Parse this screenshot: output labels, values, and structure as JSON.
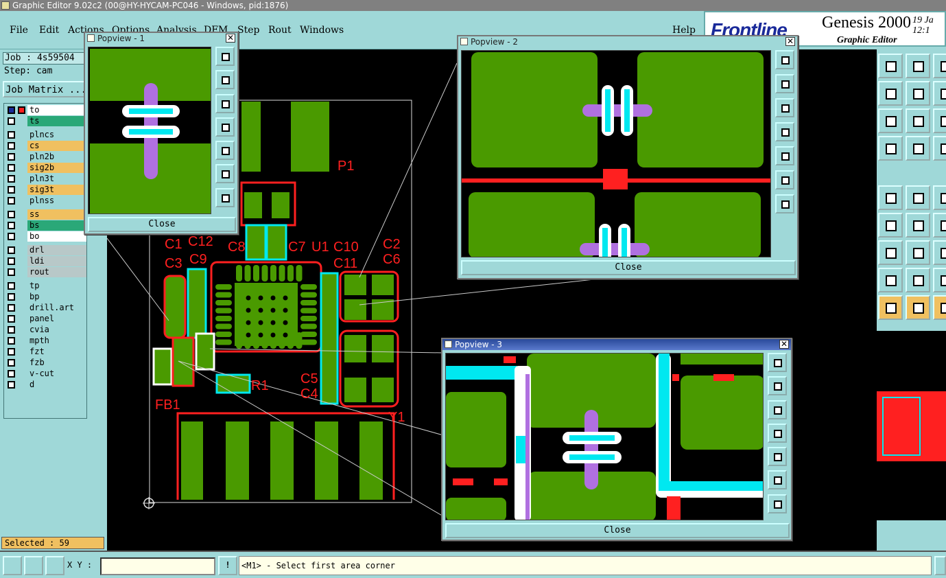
{
  "window": {
    "title": "Graphic Editor 9.02c2 (00@HY-HYCAM-PC046 - Windows, pid:1876)"
  },
  "menu": [
    "File",
    "Edit",
    "Actions",
    "Options",
    "Analysis",
    "DFM",
    "Step",
    "Rout",
    "Windows",
    "Help"
  ],
  "brand": {
    "logo": "Frontline",
    "product": "Genesis 2000",
    "subtitle": "Graphic Editor",
    "date": "19 Ja",
    "time": "12:1"
  },
  "job": {
    "job_label": "Job : 4s59504",
    "step_label": "Step: cam",
    "matrix_button": "Job Matrix ..."
  },
  "layers": [
    {
      "name": "to",
      "color": "#ffffff"
    },
    {
      "name": "ts",
      "color": "#2aa878"
    },
    {
      "name": "plncs",
      "color": "#9fd8d8"
    },
    {
      "name": "cs",
      "color": "#f0c060"
    },
    {
      "name": "pln2b",
      "color": "#9fd8d8"
    },
    {
      "name": "sig2b",
      "color": "#f0c060"
    },
    {
      "name": "pln3t",
      "color": "#9fd8d8"
    },
    {
      "name": "sig3t",
      "color": "#f0c060"
    },
    {
      "name": "plnss",
      "color": "#9fd8d8"
    },
    {
      "name": "ss",
      "color": "#f0c060"
    },
    {
      "name": "bs",
      "color": "#2aa878"
    },
    {
      "name": "bo",
      "color": "#ffffff"
    },
    {
      "name": "drl",
      "color": "#b8c8c8"
    },
    {
      "name": "ldi",
      "color": "#b8c8c8"
    },
    {
      "name": "rout",
      "color": "#b8c8c8"
    },
    {
      "name": "tp",
      "color": "#9fd8d8"
    },
    {
      "name": "bp",
      "color": "#9fd8d8"
    },
    {
      "name": "drill.art",
      "color": "#9fd8d8"
    },
    {
      "name": "panel",
      "color": "#9fd8d8"
    },
    {
      "name": "cvia",
      "color": "#9fd8d8"
    },
    {
      "name": "mpth",
      "color": "#9fd8d8"
    },
    {
      "name": "fzt",
      "color": "#9fd8d8"
    },
    {
      "name": "fzb",
      "color": "#9fd8d8"
    },
    {
      "name": "v-cut",
      "color": "#9fd8d8"
    },
    {
      "name": "d",
      "color": "#9fd8d8"
    }
  ],
  "board_labels": [
    "P1",
    "C1",
    "C12",
    "C3",
    "C9",
    "C8",
    "C7",
    "U1",
    "C10",
    "C11",
    "C2",
    "C6",
    "C5",
    "C4",
    "R1",
    "FB1",
    "Y1"
  ],
  "popviews": [
    {
      "title": "Popview - 1",
      "close": "Close"
    },
    {
      "title": "Popview - 2",
      "close": "Close"
    },
    {
      "title": "Popview - 3",
      "close": "Close"
    }
  ],
  "status": {
    "selected": "Selected : 59",
    "xy_label": "X Y :",
    "xy_value": "",
    "prompt": "<M1> - Select first area corner",
    "alert": "!"
  },
  "colors": {
    "copper": "#4a9a00",
    "outline": "#ff2020",
    "highlight": "#00e8f0",
    "drill": "#b070e0",
    "background": "#000000",
    "ui": "#9fd8d8"
  }
}
